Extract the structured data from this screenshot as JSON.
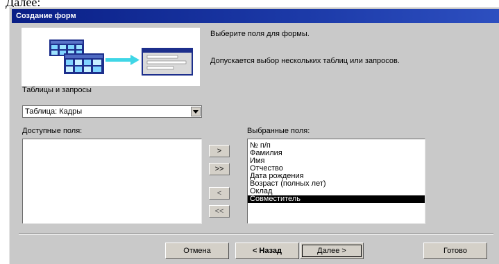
{
  "caption": "Далее:",
  "window": {
    "title": "Создание форм"
  },
  "header": {
    "instruction": "Выберите поля для формы.",
    "hint": "Допускается выбор нескольких таблиц или запросов."
  },
  "source": {
    "label": "Таблицы и запросы",
    "selected": "Таблица: Кадры"
  },
  "available": {
    "label": "Доступные поля:",
    "items": []
  },
  "selected_fields": {
    "label": "Выбранные поля:",
    "items": [
      "№ п/п",
      "Фамилия",
      "Имя",
      "Отчество",
      "Дата рождения",
      "Возраст (полных лет)",
      "Оклад",
      "Совместитель"
    ],
    "highlighted_index": 7
  },
  "move_buttons": {
    "add_one": ">",
    "add_all": ">>",
    "remove_one": "<",
    "remove_all": "<<"
  },
  "footer": {
    "cancel": "Отмена",
    "back": "< Назад",
    "next": "Далее >",
    "finish": "Готово"
  },
  "colors": {
    "titlebar": "#0a1f86",
    "dialog_bg": "#c9c9c9",
    "selection": "#000000"
  }
}
